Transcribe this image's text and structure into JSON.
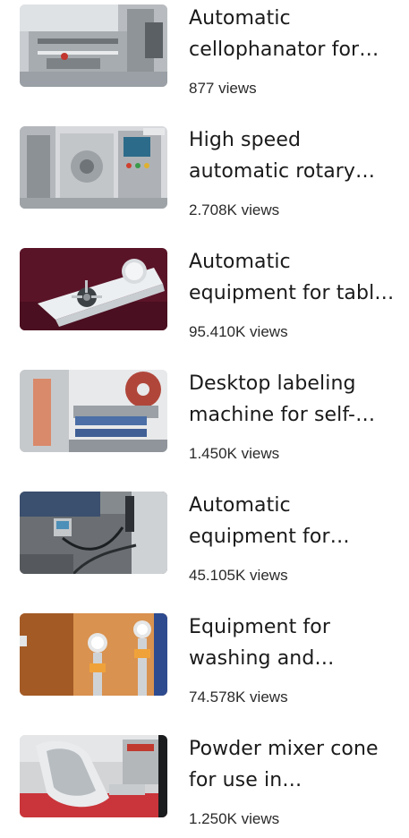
{
  "videos": [
    {
      "title": "Automatic cellophanator for packaging",
      "views": "877 views",
      "thumb_icon": "cellophanator-machine-thumbnail"
    },
    {
      "title": "High speed automatic rotary capsule filling machine",
      "views": "2.708K views",
      "thumb_icon": "rotary-machine-thumbnail"
    },
    {
      "title": "Automatic equipment for tablet testing",
      "views": "95.410K views",
      "thumb_icon": "testing-equipment-thumbnail"
    },
    {
      "title": "Desktop labeling machine for self-adhesive labels",
      "views": "1.450K views",
      "thumb_icon": "labeling-machine-thumbnail"
    },
    {
      "title": "Automatic equipment for coding and marking",
      "views": "45.105K views",
      "thumb_icon": "coding-equipment-thumbnail"
    },
    {
      "title": "Equipment for washing and sterilization",
      "views": "74.578K views",
      "thumb_icon": "washing-equipment-thumbnail"
    },
    {
      "title": "Powder mixer cone for use in pharmaceutical production",
      "views": "1.250K views",
      "thumb_icon": "powder-mixer-thumbnail"
    }
  ]
}
